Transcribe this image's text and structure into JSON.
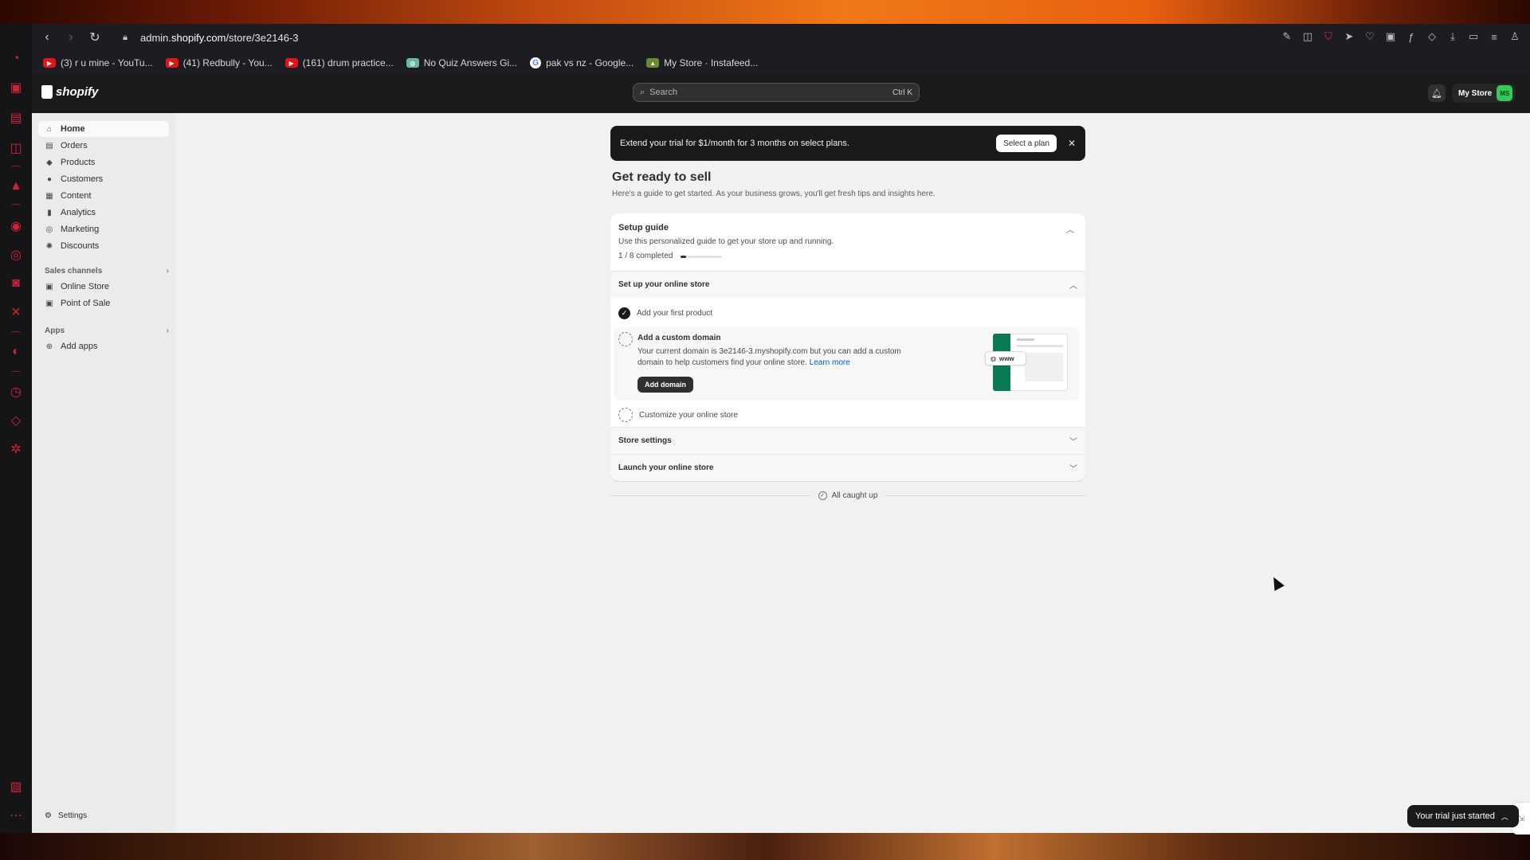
{
  "browser": {
    "url_prefix": "admin.",
    "url_domain": "shopify.com",
    "url_path": "/store/3e2146-3",
    "bookmarks": [
      {
        "label": "(3) r u mine - YouTu...",
        "icon": "youtube-icon"
      },
      {
        "label": "(41) Redbully - You...",
        "icon": "youtube-icon"
      },
      {
        "label": "(161) drum practice...",
        "icon": "youtube-icon"
      },
      {
        "label": "No Quiz Answers Gi...",
        "icon": "quiz-icon"
      },
      {
        "label": "pak vs nz - Google...",
        "icon": "google-icon"
      },
      {
        "label": "My Store · Instafeed...",
        "icon": "instafeed-icon"
      }
    ]
  },
  "topbar": {
    "brand": "shopify",
    "search_placeholder": "Search",
    "search_shortcut": "Ctrl K",
    "store_name": "My Store",
    "store_avatar": "MS"
  },
  "sidebar": {
    "items": [
      {
        "label": "Home",
        "icon": "home-icon",
        "active": true
      },
      {
        "label": "Orders",
        "icon": "orders-icon"
      },
      {
        "label": "Products",
        "icon": "tag-icon"
      },
      {
        "label": "Customers",
        "icon": "person-icon"
      },
      {
        "label": "Content",
        "icon": "content-icon"
      },
      {
        "label": "Analytics",
        "icon": "bar-chart-icon"
      },
      {
        "label": "Marketing",
        "icon": "target-icon"
      },
      {
        "label": "Discounts",
        "icon": "discount-icon"
      }
    ],
    "sales_channels_title": "Sales channels",
    "sales_channels": [
      {
        "label": "Online Store",
        "icon": "store-icon"
      },
      {
        "label": "Point of Sale",
        "icon": "pos-icon"
      }
    ],
    "apps_title": "Apps",
    "add_apps": "Add apps",
    "settings": "Settings"
  },
  "banner": {
    "text": "Extend your trial for $1/month for 3 months on select plans.",
    "button": "Select a plan"
  },
  "main": {
    "title": "Get ready to sell",
    "subtitle": "Here's a guide to get started. As your business grows, you'll get fresh tips and insights here."
  },
  "setup_guide": {
    "title": "Setup guide",
    "subtitle": "Use this personalized guide to get your store up and running.",
    "progress_text": "1 / 8 completed",
    "progress_fraction": 0.125,
    "section_online_store": "Set up your online store",
    "task_done": "Add your first product",
    "task_domain_title": "Add a custom domain",
    "task_domain_desc": "Your current domain is 3e2146-3.myshopify.com but you can add a custom domain to help customers find your online store.",
    "task_domain_link": "Learn more",
    "task_domain_button": "Add domain",
    "illustration_label": "www",
    "task_customize": "Customize your online store",
    "section_store_settings": "Store settings",
    "section_launch": "Launch your online store"
  },
  "caught_up": "All caught up",
  "trial_toast": "Your trial just started"
}
